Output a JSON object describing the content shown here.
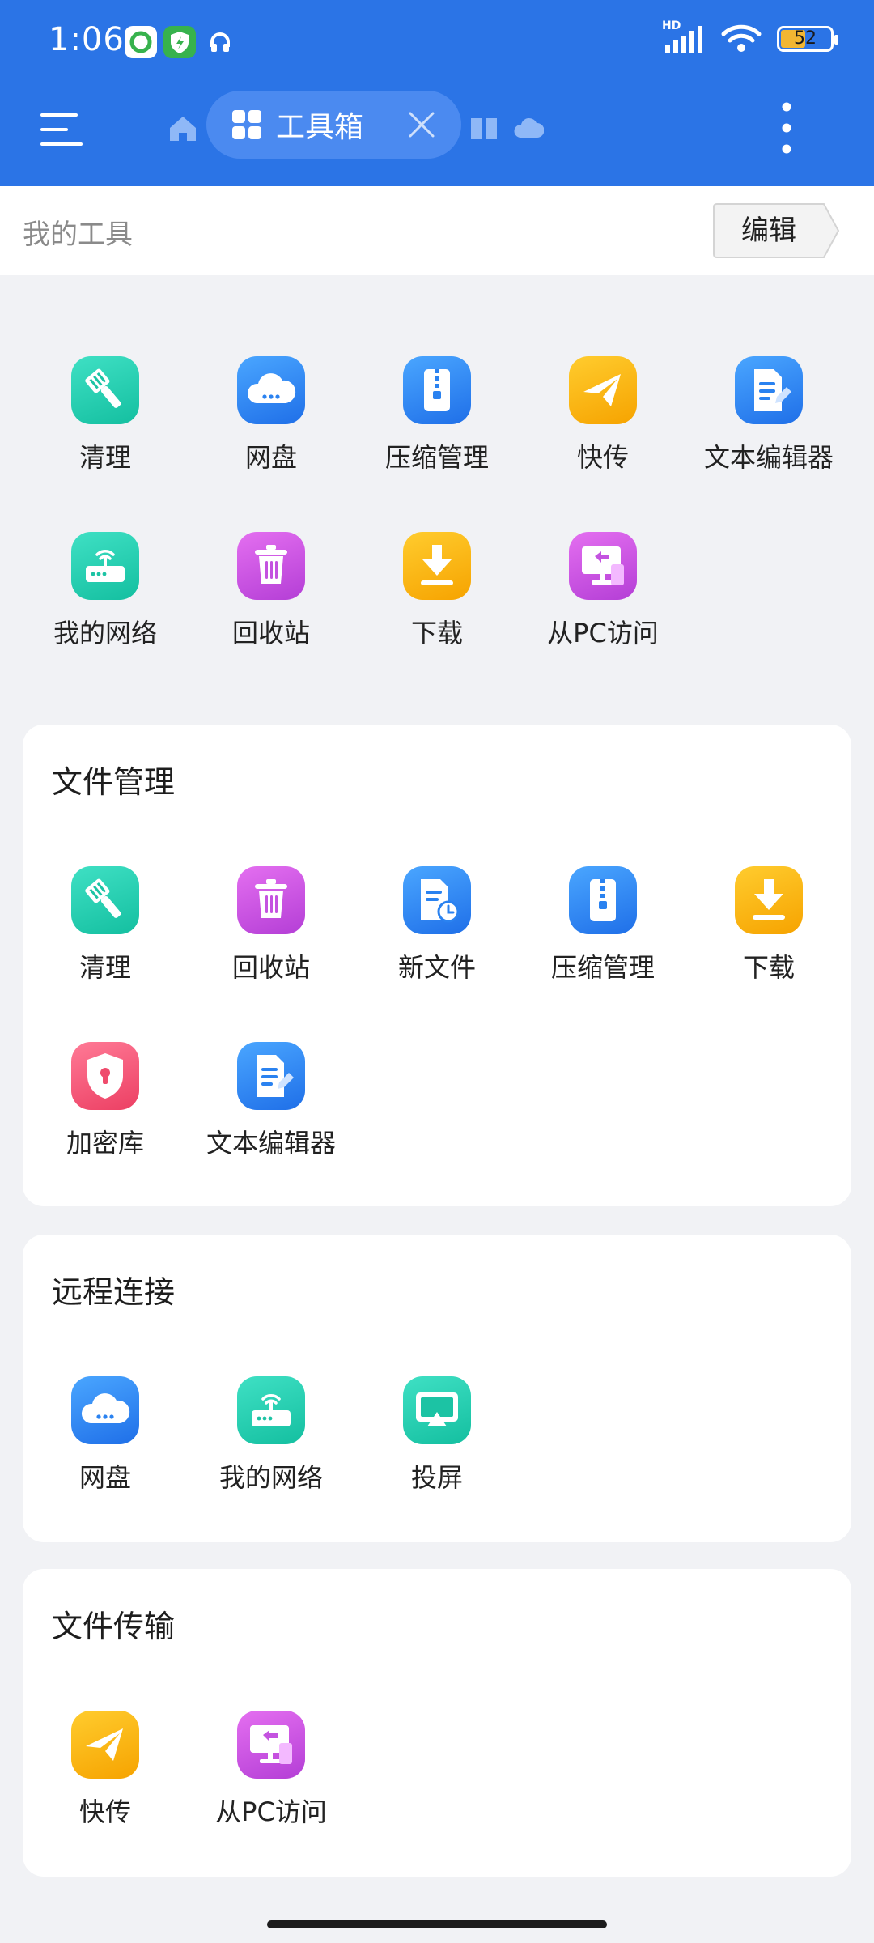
{
  "status_bar": {
    "time": "1:06",
    "battery": "52",
    "network": "HD"
  },
  "toolbar": {
    "tab_label": "工具箱"
  },
  "my_tools": {
    "label": "我的工具",
    "edit_label": "编辑",
    "items": [
      {
        "label": "清理",
        "icon": "broom-icon"
      },
      {
        "label": "网盘",
        "icon": "cloud-drive-icon"
      },
      {
        "label": "压缩管理",
        "icon": "zip-icon"
      },
      {
        "label": "快传",
        "icon": "paper-plane-icon"
      },
      {
        "label": "文本编辑器",
        "icon": "text-editor-icon"
      },
      {
        "label": "我的网络",
        "icon": "router-icon"
      },
      {
        "label": "回收站",
        "icon": "trash-icon"
      },
      {
        "label": "下载",
        "icon": "download-icon"
      },
      {
        "label": "从PC访问",
        "icon": "pc-access-icon"
      }
    ]
  },
  "sections": [
    {
      "title": "文件管理",
      "items": [
        {
          "label": "清理"
        },
        {
          "label": "回收站"
        },
        {
          "label": "新文件"
        },
        {
          "label": "压缩管理"
        },
        {
          "label": "下载"
        },
        {
          "label": "加密库"
        },
        {
          "label": "文本编辑器"
        }
      ]
    },
    {
      "title": "远程连接",
      "items": [
        {
          "label": "网盘"
        },
        {
          "label": "我的网络"
        },
        {
          "label": "投屏"
        }
      ]
    },
    {
      "title": "文件传输",
      "items": [
        {
          "label": "快传"
        },
        {
          "label": "从PC访问"
        }
      ]
    }
  ],
  "colors": {
    "header": "#2b74e6",
    "teal": "#14bfa0",
    "blue": "#1f6fe8",
    "orange": "#f6a300",
    "purple": "#b43ed6",
    "pink": "#ec3f63"
  }
}
